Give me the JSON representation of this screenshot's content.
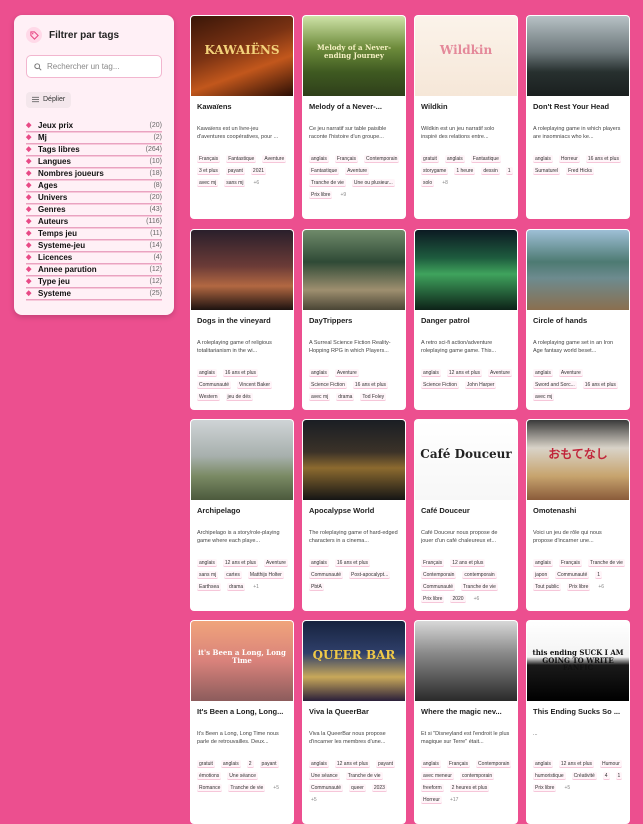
{
  "sidebar": {
    "title": "Filtrer par tags",
    "search_placeholder": "Rechercher un tag...",
    "expand_label": "Déplier",
    "categories": [
      {
        "name": "Jeux prix",
        "count": "(20)"
      },
      {
        "name": "Mj",
        "count": "(2)"
      },
      {
        "name": "Tags libres",
        "count": "(264)"
      },
      {
        "name": "Langues",
        "count": "(10)"
      },
      {
        "name": "Nombres joueurs",
        "count": "(18)"
      },
      {
        "name": "Ages",
        "count": "(8)"
      },
      {
        "name": "Univers",
        "count": "(20)"
      },
      {
        "name": "Genres",
        "count": "(43)"
      },
      {
        "name": "Auteurs",
        "count": "(116)"
      },
      {
        "name": "Temps jeu",
        "count": "(11)"
      },
      {
        "name": "Systeme-jeu",
        "count": "(14)"
      },
      {
        "name": "Licences",
        "count": "(4)"
      },
      {
        "name": "Annee parution",
        "count": "(12)"
      },
      {
        "name": "Type jeu",
        "count": "(12)"
      },
      {
        "name": "Systeme",
        "count": "(25)"
      }
    ]
  },
  "cards": [
    {
      "title": "Kawaïens",
      "cover_text": "KAWAIËNS",
      "desc": "Kawaïens est un livre-jeu d'aventures coopératives, pour ...",
      "tags": [
        "Français",
        "Fantastique",
        "Aventure",
        "3 et plus",
        "payant",
        "2021",
        "avec mj",
        "sans mj",
        "+6"
      ]
    },
    {
      "title": "Melody of a Never-...",
      "cover_text": "Melody of a Never-ending Journey",
      "desc": "Ce jeu narratif sur table paisible raconte l'histoire d'un groupe...",
      "tags": [
        "anglais",
        "Français",
        "Contemporain",
        "Fantastique",
        "Aventure",
        "Tranche de vie",
        "Une ou plusieur...",
        "Prix libre",
        "+9"
      ]
    },
    {
      "title": "Wildkin",
      "cover_text": "Wildkin",
      "desc": "Wildkin est un jeu narratif solo inspiré des relations entre...",
      "tags": [
        "gratuit",
        "anglais",
        "Fantastique",
        "storygame",
        "1 heure",
        "dessin",
        "1",
        "solo",
        "+8"
      ]
    },
    {
      "title": "Don't Rest Your Head",
      "cover_text": "",
      "desc": "A roleplaying game in which players are insomniacs who ke...",
      "tags": [
        "anglais",
        "Horreur",
        "16 ans et plus",
        "Surnaturel",
        "Fred Hicks"
      ]
    },
    {
      "title": "Dogs in the vineyard",
      "cover_text": "",
      "desc": "A roleplaying game of religious totalitarianism in the wi...",
      "tags": [
        "anglais",
        "16 ans et plus",
        "Communauté",
        "Vincent Baker",
        "Western",
        "jeu de dés"
      ]
    },
    {
      "title": "DayTrippers",
      "cover_text": "",
      "desc": "A Surreal Science Fiction Reality-Hopping RPG in which Players...",
      "tags": [
        "anglais",
        "Aventure",
        "Science Fiction",
        "16 ans et plus",
        "avec mj",
        "drama",
        "Tod Foley"
      ]
    },
    {
      "title": "Danger patrol",
      "cover_text": "",
      "desc": "A retro sci-fi action/adventure roleplaying game game. This...",
      "tags": [
        "anglais",
        "12 ans et plus",
        "Aventure",
        "Science Fiction",
        "John Harper"
      ]
    },
    {
      "title": "Circle of hands",
      "cover_text": "",
      "desc": "A roleplaying game set in an Iron Age fantasy world beset...",
      "tags": [
        "anglais",
        "Aventure",
        "Sword and Sorc...",
        "16 ans et plus",
        "avec mj"
      ]
    },
    {
      "title": "Archipelago",
      "cover_text": "",
      "desc": "Archipelago is a story/role-playing game where each playe...",
      "tags": [
        "anglais",
        "12 ans et plus",
        "Aventure",
        "sans mj",
        "cartes",
        "Matthijs Holter",
        "Earthsea",
        "drama",
        "+1"
      ]
    },
    {
      "title": "Apocalypse World",
      "cover_text": "",
      "desc": "The roleplaying game of hard-edged characters in a cinema...",
      "tags": [
        "anglais",
        "16 ans et plus",
        "Communauté",
        "Post-apocalypt...",
        "PbtA"
      ]
    },
    {
      "title": "Café Douceur",
      "cover_text": "Café Douceur",
      "desc": "Café Douceur nous propose de jouer d'un café chaleureux et...",
      "tags": [
        "Français",
        "12 ans et plus",
        "Contemporain",
        "contemporain",
        "Communauté",
        "Tranche de vie",
        "Prix libre",
        "2020",
        "+6"
      ]
    },
    {
      "title": "Omotenashi",
      "cover_text": "おもてなし",
      "desc": "Voici un jeu de rôle qui nous propose d'incarner une...",
      "tags": [
        "anglais",
        "Français",
        "Tranche de vie",
        "japon",
        "Communauté",
        "1",
        "Tout public",
        "Prix libre",
        "+6"
      ]
    },
    {
      "title": "It's Been a Long, Long...",
      "cover_text": "it's Been a Long, Long Time",
      "desc": "It's Been a Long, Long Time nous parle de retrouvailles. Deux...",
      "tags": [
        "gratuit",
        "anglais",
        "2",
        "payant",
        "émotions",
        "Une séance",
        "Romance",
        "Tranche de vie",
        "+5"
      ]
    },
    {
      "title": "Viva la QueerBar",
      "cover_text": "QUEER BAR",
      "desc": "Viva la QueerBar nous propose d'incarner les membres d'une...",
      "tags": [
        "anglais",
        "12 ans et plus",
        "payant",
        "Une séance",
        "Tranche de vie",
        "Communauté",
        "queer",
        "2023",
        "+5"
      ]
    },
    {
      "title": "Where the magic nev...",
      "cover_text": "",
      "desc": "Et si \"Disneyland est l'endroit le plus magique sur Terre\" était...",
      "tags": [
        "anglais",
        "Français",
        "Contemporain",
        "avec meneur",
        "contemporain",
        "freeform",
        "2 heures et plus",
        "Horreur",
        "+17"
      ]
    },
    {
      "title": "This Ending Sucks So ...",
      "cover_text": "this ending SUCK I AM GOING TO WRITE FANFIC",
      "desc": "...",
      "tags": [
        "anglais",
        "12 ans et plus",
        "Humour",
        "humoristique",
        "Créativité",
        "4",
        "1",
        "Prix libre",
        "+5"
      ]
    }
  ],
  "colors": {
    "background": "#ec4f8f",
    "accent": "#e84a86"
  }
}
